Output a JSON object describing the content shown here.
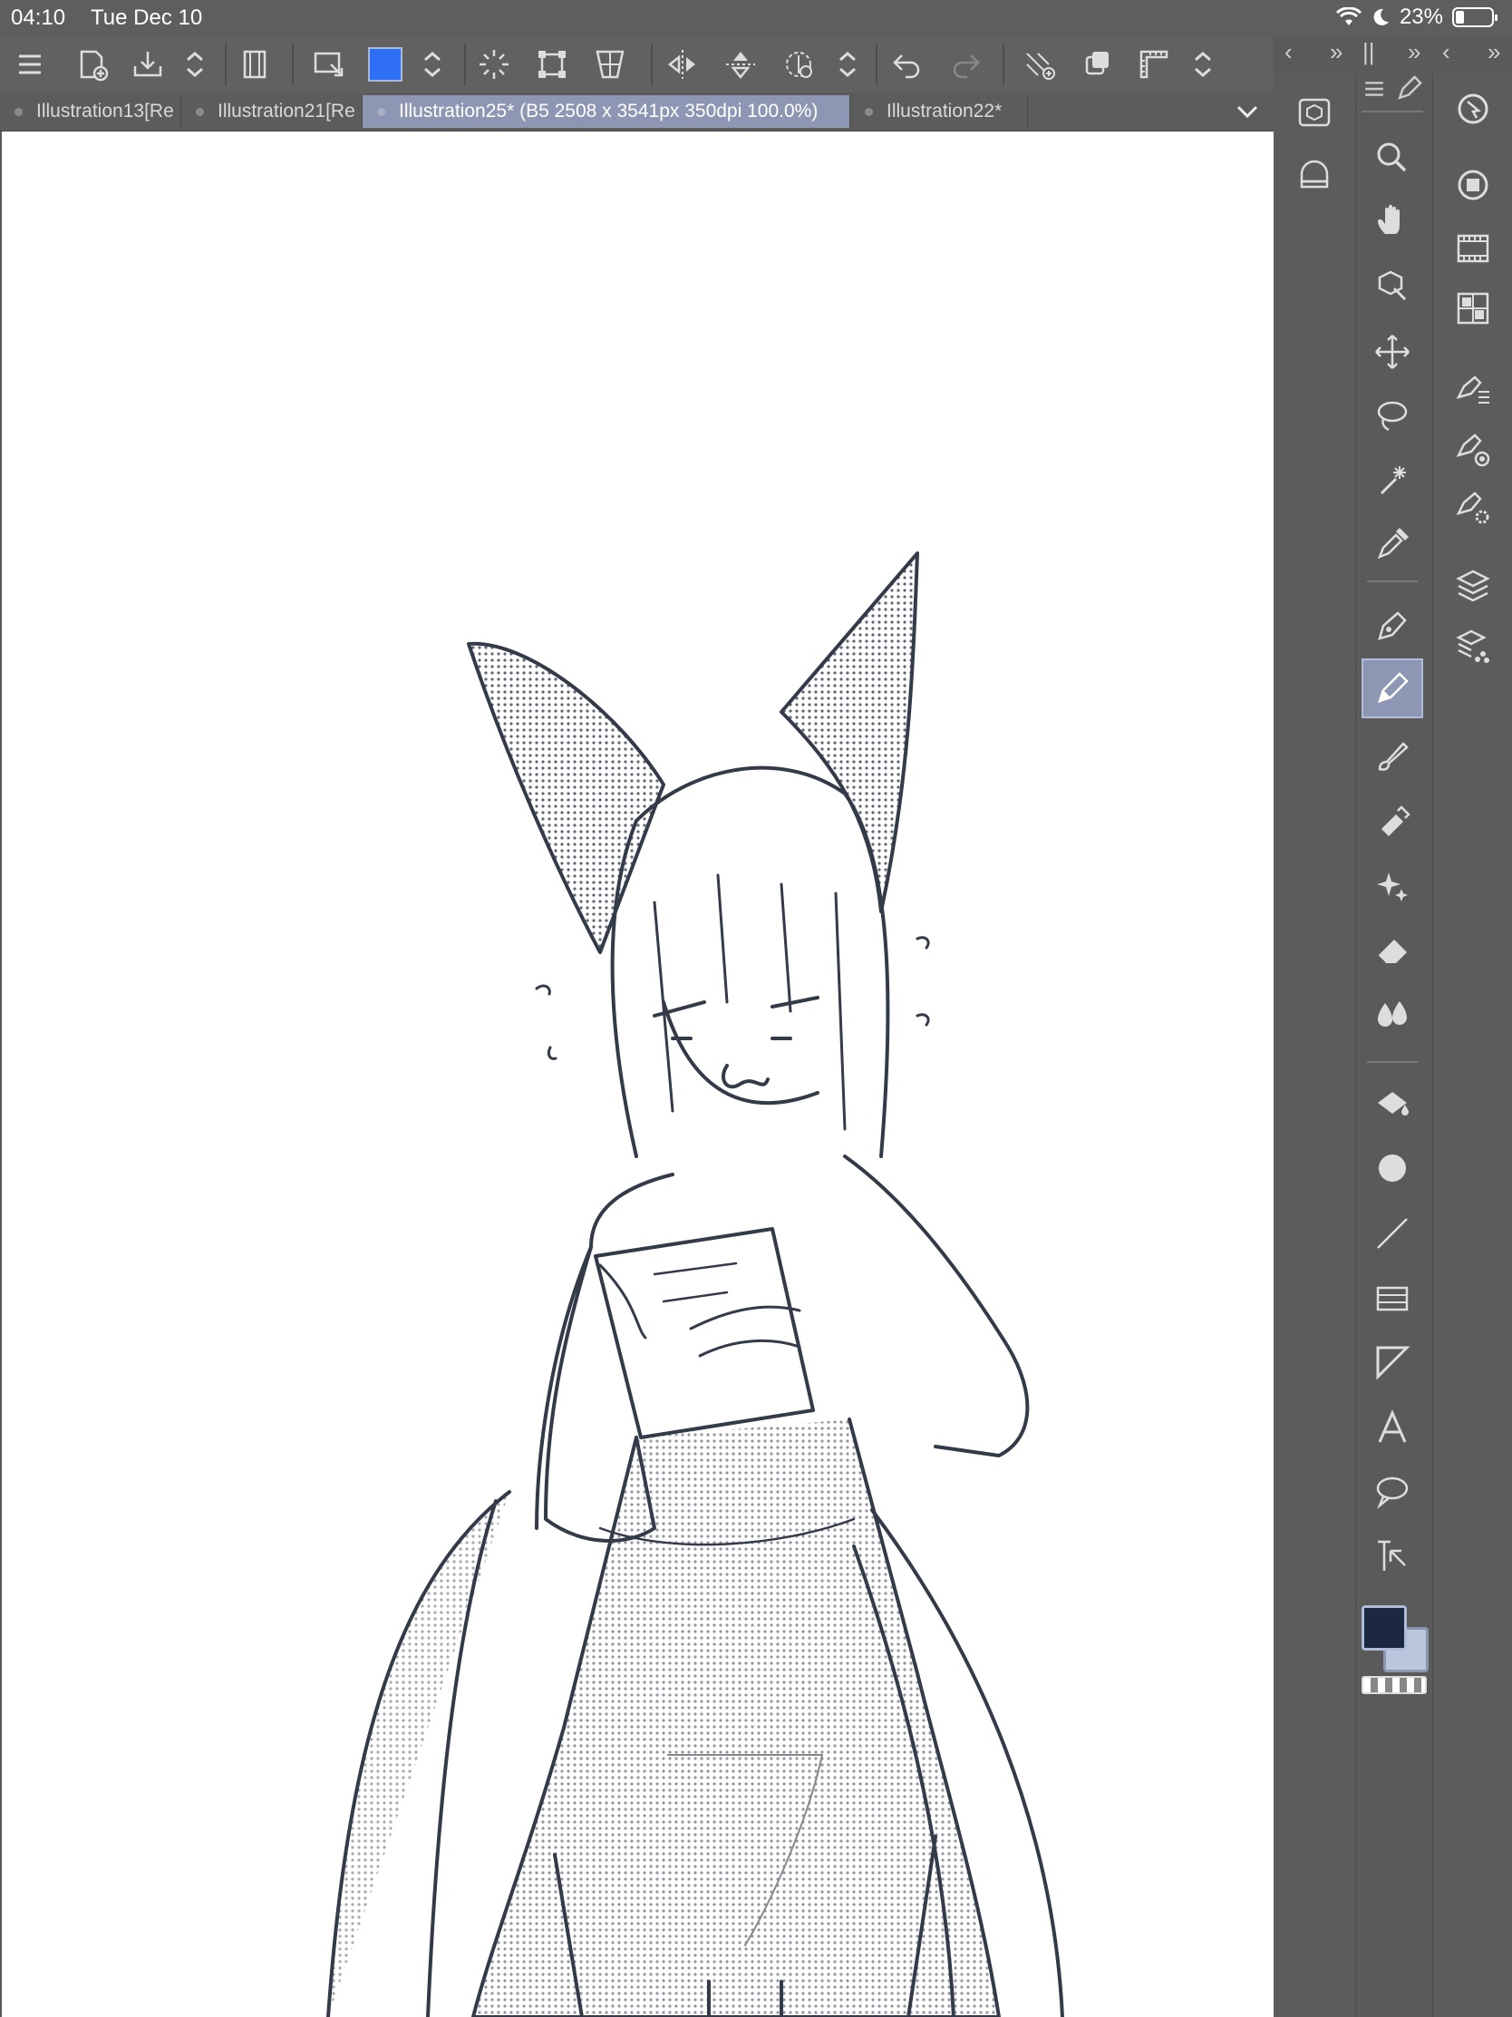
{
  "status_bar": {
    "time": "04:10",
    "date": "Tue Dec 10",
    "battery": "23%",
    "battery_level": 0.23
  },
  "toolbar": {
    "current_color": "#2f6ff5",
    "icons": [
      "menu-icon",
      "new-canvas-icon",
      "save-icon",
      "stepper-icon",
      "frame-icon",
      "select-layer-icon",
      "color-swatch",
      "stepper-icon",
      "selection-spinner-icon",
      "transform-icon",
      "mesh-icon",
      "flip-horizontal-icon",
      "flip-vertical-icon",
      "rotate-icon",
      "stepper-icon",
      "undo-icon",
      "redo-icon",
      "snap-icon",
      "duplicate-icon",
      "ruler-icon",
      "stepper-icon"
    ]
  },
  "tabs": [
    {
      "label": "Illustration13[Re",
      "active": false
    },
    {
      "label": "Illustration21[Re",
      "active": false
    },
    {
      "label": "Illustration25* (B5 2508 x 3541px 350dpi 100.0%)",
      "active": true
    },
    {
      "label": "Illustration22*",
      "active": false
    }
  ],
  "panel_header": {
    "left_chevron": "‹",
    "expand": "»",
    "bars": "||",
    "expand2": "»",
    "left_chevron2": "‹",
    "expand3": "»"
  },
  "tools": [
    "zoom",
    "hand",
    "operation",
    "move",
    "lasso",
    "magic-wand",
    "eyedropper",
    "pen",
    "pencil",
    "brush",
    "airbrush",
    "decoration",
    "eraser",
    "blend",
    "fill",
    "figure",
    "line",
    "gradient",
    "frame-border",
    "text",
    "balloon",
    "correct-line"
  ],
  "colors": {
    "main": "#1b2840",
    "sub": "#b9c6dc",
    "accent": "#8d96b2"
  }
}
